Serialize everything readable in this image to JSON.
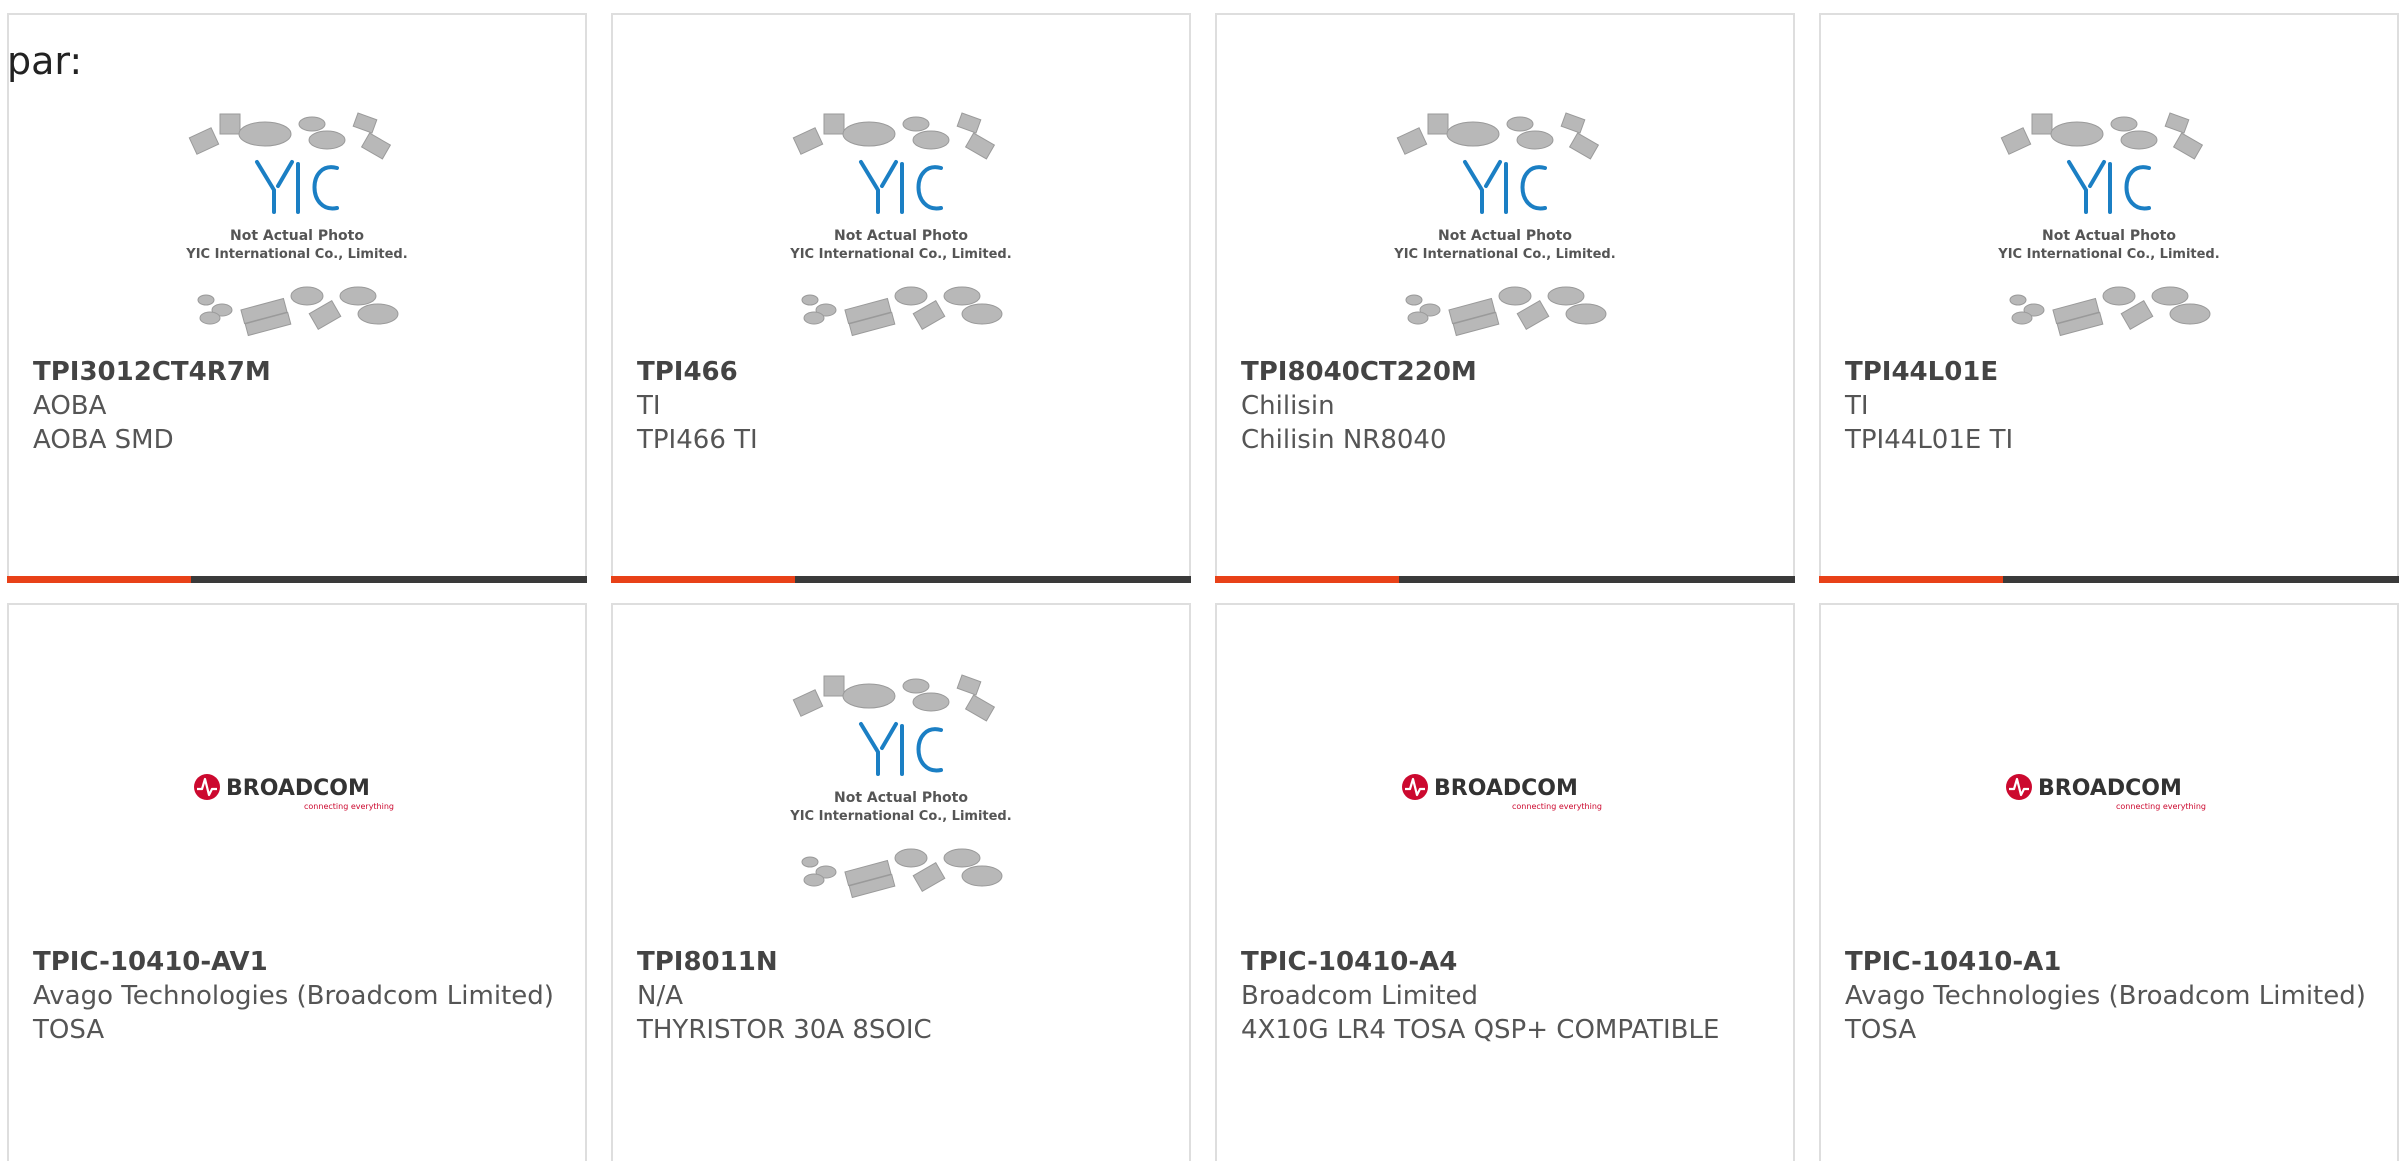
{
  "header": {
    "prefix_text": "par:"
  },
  "placeholder_image": {
    "line1": "Not Actual Photo",
    "line2": "YIC International Co., Limited.",
    "logo_text": "YIC"
  },
  "broadcom_logo": {
    "name": "BROADCOM",
    "tagline": "connecting everything"
  },
  "products": [
    {
      "part_number": "TPI3012CT4R7M",
      "manufacturer": "AOBA",
      "description": "AOBA SMD",
      "image": "placeholder"
    },
    {
      "part_number": "TPI466",
      "manufacturer": "TI",
      "description": "TPI466 TI",
      "image": "placeholder"
    },
    {
      "part_number": "TPI8040CT220M",
      "manufacturer": "Chilisin",
      "description": "Chilisin NR8040",
      "image": "placeholder"
    },
    {
      "part_number": "TPI44L01E",
      "manufacturer": "TI",
      "description": "TPI44L01E TI",
      "image": "placeholder"
    },
    {
      "part_number": "TPIC-10410-AV1",
      "manufacturer": "Avago Technologies (Broadcom Limited)",
      "description": "TOSA",
      "image": "broadcom"
    },
    {
      "part_number": "TPI8011N",
      "manufacturer": "N/A",
      "description": "THYRISTOR 30A 8SOIC",
      "image": "placeholder"
    },
    {
      "part_number": "TPIC-10410-A4",
      "manufacturer": "Broadcom Limited",
      "description": "4X10G LR4 TOSA QSP+ COMPATIBLE",
      "image": "broadcom"
    },
    {
      "part_number": "TPIC-10410-A1",
      "manufacturer": "Avago Technologies (Broadcom Limited)",
      "description": "TOSA",
      "image": "broadcom"
    }
  ],
  "colors": {
    "accent_red": "#e84118",
    "accent_dark": "#3a3a3a",
    "yic_blue": "#1b7fc4",
    "broadcom_red": "#cc092f"
  }
}
